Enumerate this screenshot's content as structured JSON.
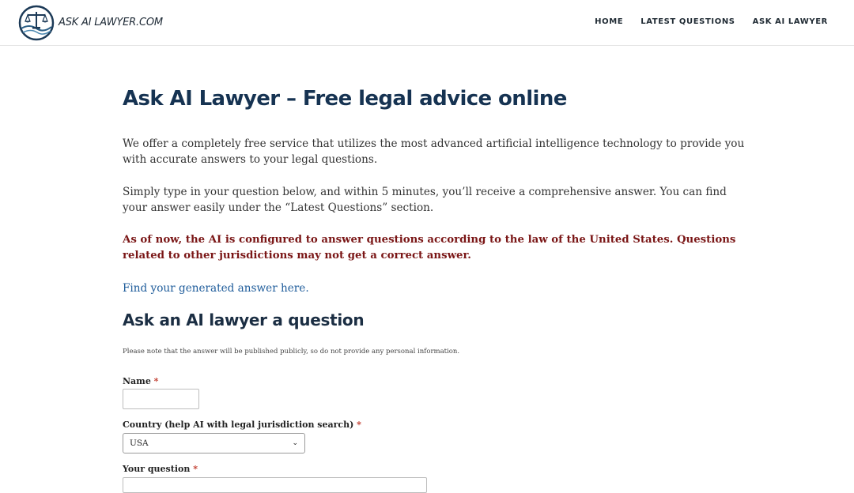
{
  "header": {
    "logo_text": "ASK AI LAWYER.COM",
    "nav": [
      {
        "label": "HOME"
      },
      {
        "label": "LATEST QUESTIONS"
      },
      {
        "label": "ASK AI LAWYER"
      }
    ]
  },
  "main": {
    "title": "Ask AI Lawyer – Free legal advice online",
    "intro": "We offer a completely free service that utilizes the most advanced artificial intelligence technology to provide you with accurate answers to your legal questions.",
    "instructions": "Simply type in your question below, and within 5 minutes, you’ll receive a comprehensive answer. You can find your answer easily under the “Latest Questions” section.",
    "notice": "As of now, the AI is configured to answer questions according to the law of the United States. Questions related to other jurisdictions may not get a correct answer.",
    "answer_link": "Find your generated answer here."
  },
  "form": {
    "heading": "Ask an AI lawyer a question",
    "privacy_note": "Please note that the answer will be published publicly, so do not provide any personal information.",
    "name_label": "Name",
    "country_label": "Country (help AI with legal jurisdiction search)",
    "country_value": "USA",
    "question_label": "Your question",
    "required_marker": "*"
  },
  "colors": {
    "title": "#163352",
    "notice": "#7a1616",
    "link": "#1d5b9a",
    "required": "#c0392b"
  }
}
